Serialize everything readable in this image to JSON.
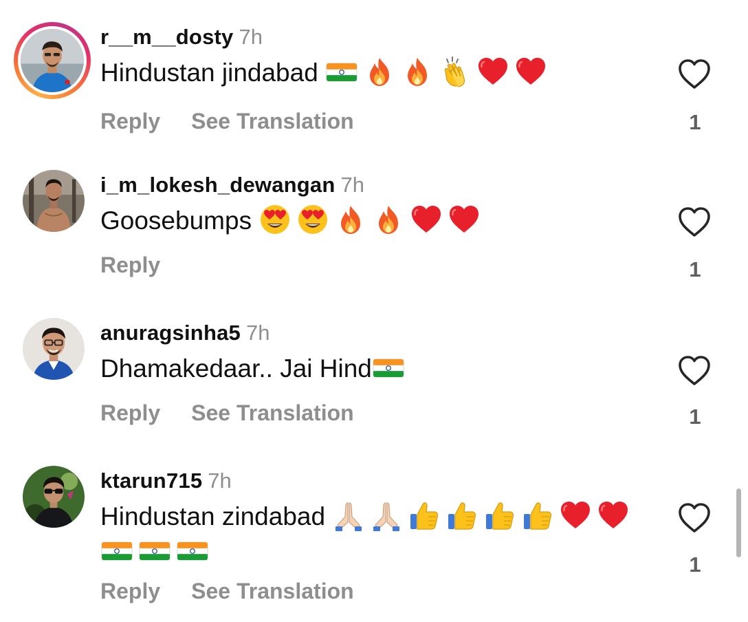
{
  "comments": [
    {
      "username": "r__m__dosty",
      "time": "7h",
      "text": "Hindustan jindabad",
      "emojis": [
        "flag-india",
        "fire",
        "fire",
        "clap",
        "heart",
        "heart"
      ],
      "reply_label": "Reply",
      "translate_label": "See Translation",
      "likes": "1",
      "has_story": true
    },
    {
      "username": "i_m_lokesh_dewangan",
      "time": "7h",
      "text": "Goosebumps",
      "emojis": [
        "heart-eyes",
        "heart-eyes",
        "fire",
        "fire",
        "heart",
        "heart"
      ],
      "reply_label": "Reply",
      "translate_label": "",
      "likes": "1",
      "has_story": false
    },
    {
      "username": "anuragsinha5",
      "time": "7h",
      "text": "Dhamakedaar.. Jai Hind",
      "emojis": [
        "flag-india"
      ],
      "reply_label": "Reply",
      "translate_label": "See Translation",
      "likes": "1",
      "has_story": false
    },
    {
      "username": "ktarun715",
      "time": "7h",
      "text": "Hindustan zindabad",
      "emojis": [
        "folded-hands",
        "folded-hands",
        "thumbs-up",
        "thumbs-up",
        "thumbs-up",
        "thumbs-up",
        "heart",
        "heart",
        "flag-india",
        "flag-india",
        "flag-india"
      ],
      "reply_label": "Reply",
      "translate_label": "See Translation",
      "likes": "1",
      "has_story": false
    }
  ],
  "colors": {
    "secondary_text": "#8e8e8e",
    "primary_text": "#111111",
    "heart_red": "#e8202b",
    "story_ring": [
      "#fcaf45",
      "#e1306c",
      "#c13584"
    ]
  }
}
